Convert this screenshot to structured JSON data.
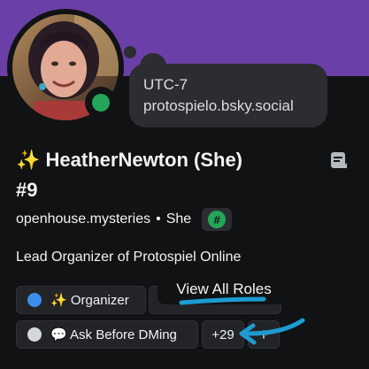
{
  "colors": {
    "banner": "#6b3fa8",
    "panel": "#111214",
    "surface": "#2b2d31",
    "status_online": "#23a55a",
    "annotation": "#1e9bd0"
  },
  "status": {
    "state": "online"
  },
  "custom_status": {
    "line1": "UTC-7",
    "line2": "protospielo.bsky.social"
  },
  "profile": {
    "emoji": "✨",
    "display_name": "HeatherNewton (She)",
    "discriminator": "#9",
    "username": "openhouse.mysteries",
    "separator": "•",
    "pronouns": "She",
    "server_tag_icon": "#",
    "bio": "Lead Organizer of Protospiel Online"
  },
  "roles": [
    {
      "label": "✨ Organizer",
      "color": "#3b8eea"
    },
    {
      "label": "",
      "color": ""
    },
    {
      "label": "💬 Ask Before DMing",
      "color": "#d4d7dc"
    }
  ],
  "roles_more": "+29",
  "roles_add": "+",
  "tooltip": "View All Roles",
  "icons": {
    "note": "note-icon",
    "tag": "server-tag-icon",
    "status": "online-status-icon"
  }
}
